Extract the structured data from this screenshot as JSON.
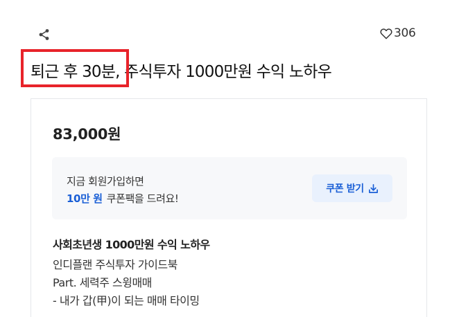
{
  "header": {
    "share_icon": "share-icon",
    "like_icon": "heart-outline-icon",
    "like_count": "306"
  },
  "product": {
    "title": "퇴근 후 30분, 주식투자 1000만원 수익 노하우",
    "price": "83,000원"
  },
  "promo": {
    "line1": "지금 회원가입하면",
    "amount": "10만 원",
    "line2_rest": "쿠폰팩을 드려요!",
    "coupon_button_label": "쿠폰 받기",
    "coupon_button_icon": "download-icon"
  },
  "description": {
    "heading": "사회초년생 1000만원 수익 노하우",
    "lines": [
      "인디플랜 주식투자 가이드북",
      "Part. 세력주 스윙매매",
      "- 내가 갑(甲)이 되는 매매 타이밍"
    ]
  },
  "colors": {
    "accent": "#1a5fd6",
    "highlight": "#e8232a",
    "promo_bg": "#f7f8fa",
    "button_bg": "#e9f1fd"
  }
}
